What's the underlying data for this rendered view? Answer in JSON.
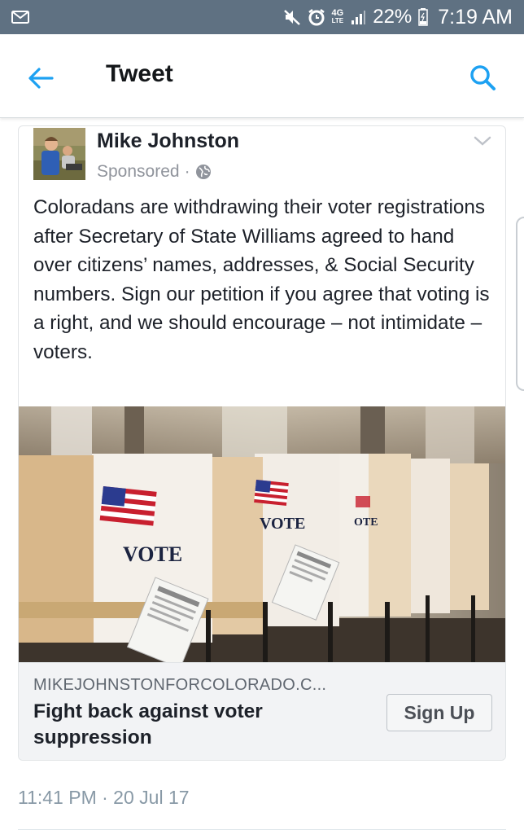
{
  "status_bar": {
    "network": "4G",
    "network_sub": "LTE",
    "battery": "22%",
    "time": "7:19 AM"
  },
  "app_bar": {
    "title": "Tweet"
  },
  "post": {
    "author": "Mike Johnston",
    "sponsored": "Sponsored",
    "separator": "·",
    "text": "Coloradans are withdrawing their voter registrations after Secretary of State Williams agreed to hand over citizens’ names, addresses, & Social Security numbers. Sign our petition if you agree that voting is a right, and we should encourage – not intimidate – voters.",
    "image_signs": [
      "VOTE",
      "VOTE",
      "OTE"
    ],
    "link": {
      "domain": "MIKEJOHNSTONFORCOLORADO.C...",
      "headline": "Fight back against voter suppression",
      "button": "Sign Up"
    }
  },
  "timestamp": "11:41 PM · 20 Jul 17",
  "colors": {
    "status_bar": "#5f7182",
    "accent": "#1da1f2",
    "link_footer": "#f2f3f5"
  },
  "icons": [
    "gmail-icon",
    "mute-icon",
    "alarm-icon",
    "signal-icon",
    "battery-icon",
    "back-arrow-icon",
    "search-icon",
    "chevron-down-icon",
    "globe-icon"
  ]
}
